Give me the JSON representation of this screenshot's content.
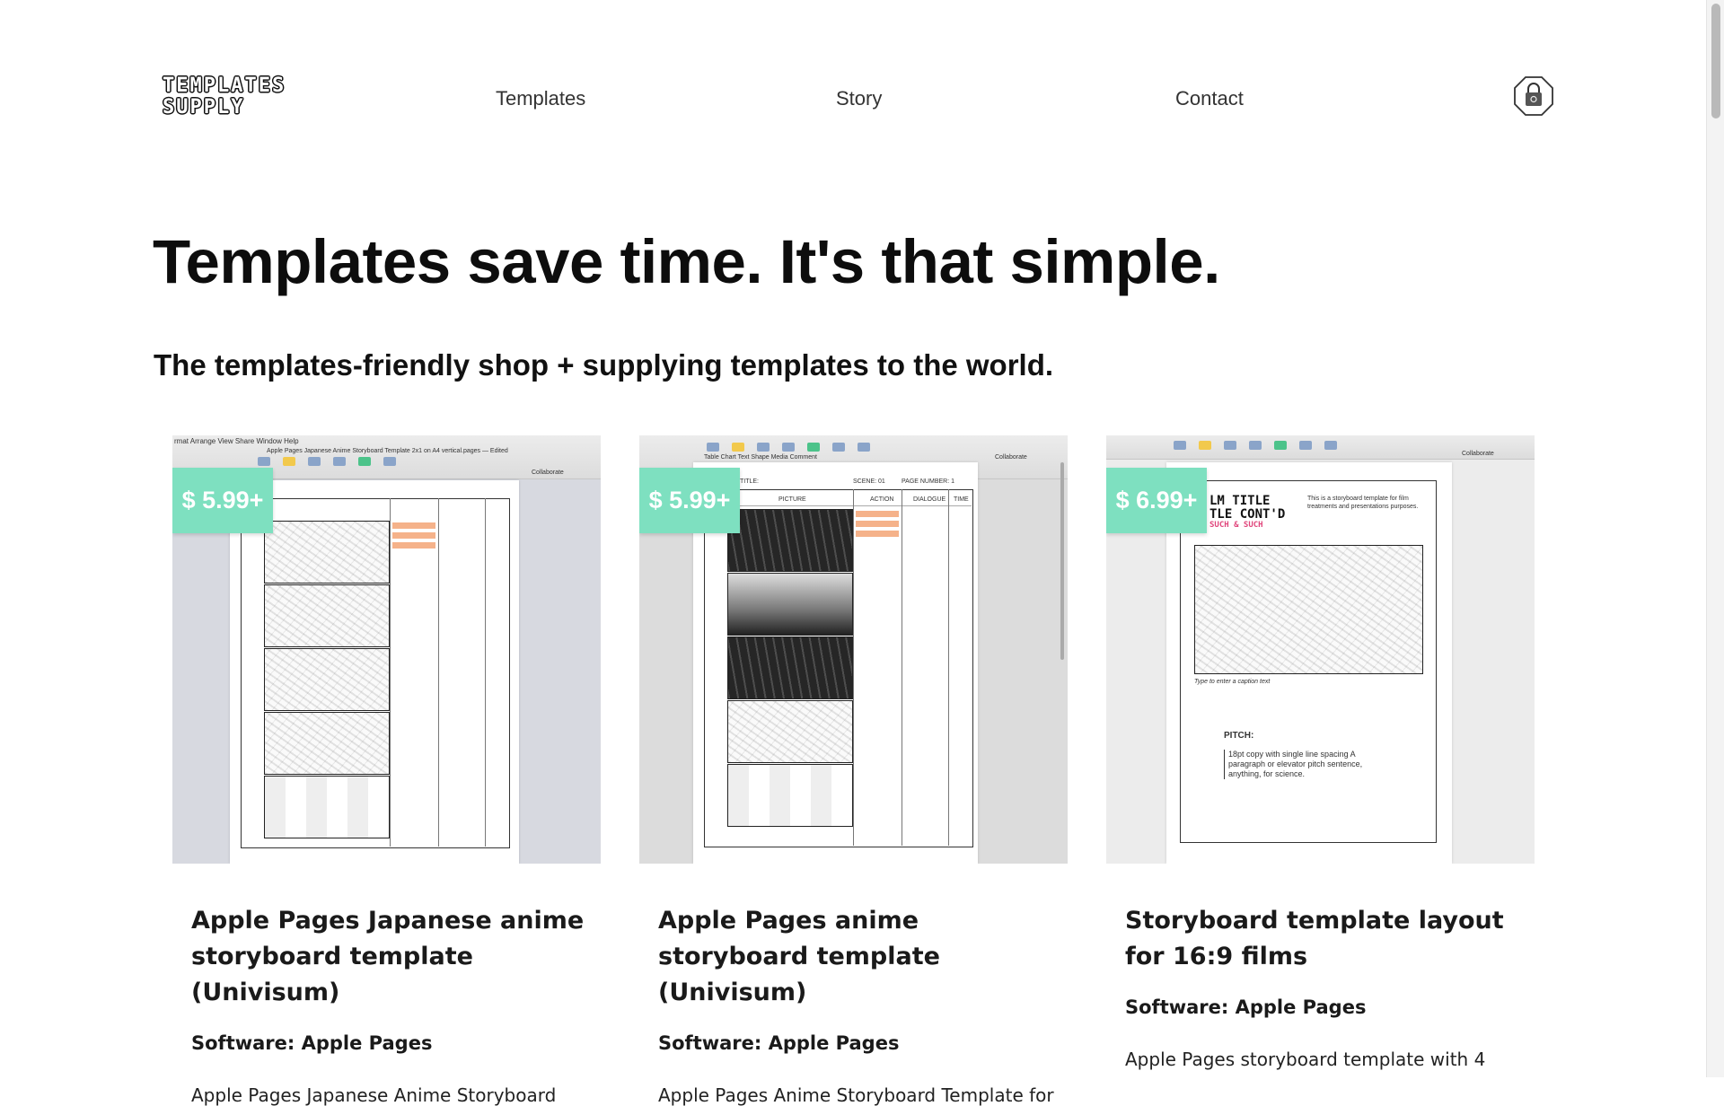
{
  "header": {
    "logo_line1": "TEMPLATES",
    "logo_line2": "SUPPLY",
    "nav": [
      "Templates",
      "Story",
      "Contact"
    ],
    "cart_icon": "lock-bag-icon"
  },
  "hero": {
    "title": "Templates save time. It's that simple.",
    "subtitle": "The templates-friendly shop + supplying templates to the world."
  },
  "colors": {
    "price_badge": "#7ee0c0",
    "text": "#111111"
  },
  "products": [
    {
      "price": "$ 5.99+",
      "title": "Apple Pages Japanese anime storyboard template (Univisum)",
      "software": "Software: Apple Pages",
      "description": "Apple Pages Japanese Anime Storyboard"
    },
    {
      "price": "$ 5.99+",
      "title": "Apple Pages anime storyboard template (Univisum)",
      "software": "Software: Apple Pages",
      "description": "Apple Pages Anime Storyboard Template for"
    },
    {
      "price": "$ 6.99+",
      "title": "Storyboard template layout for 16:9 films",
      "software": "Software: Apple Pages",
      "description": "Apple Pages storyboard template with 4"
    }
  ],
  "thumbnail_text": {
    "p1_menu": "rmat  Arrange  View  Share  Window  Help",
    "p1_window_title": "Apple Pages Japanese Anime Storyboard Template 2x1 on A4 vertical.pages — Edited",
    "toolbar_labels": "Table Chart Text Shape Media Comment",
    "collaborate": "Collaborate",
    "p2_title": "TITLE:",
    "p2_scene": "SCENE: 01",
    "p2_page": "PAGE NUMBER: 1",
    "p2_cols": [
      "PICTURE",
      "ACTION",
      "DIALOGUE",
      "TIME"
    ],
    "p3_title1": "LM TITLE",
    "p3_title2": "TLE CONT'D",
    "p3_such": "SUCH & SUCH",
    "p3_pitch": "PITCH:",
    "p3_pitch_body": "18pt copy with single line spacing A paragraph or elevator pitch sentence, anything, for science.",
    "p3_note": "This is a storyboard template for film treatments and presentations purposes.",
    "p3_caption": "Type to enter a caption text"
  }
}
